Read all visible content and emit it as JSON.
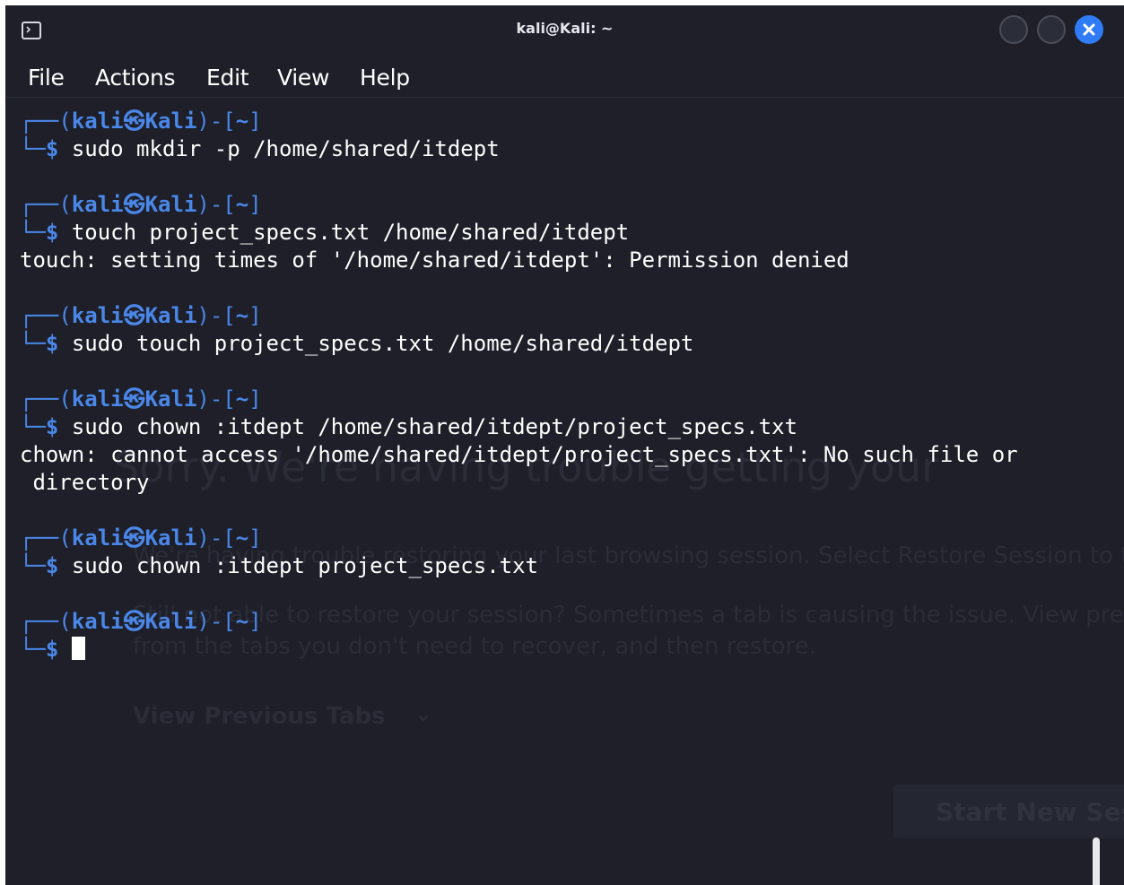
{
  "window": {
    "title": "kali@Kali: ~",
    "icons": {
      "app": "terminal-icon",
      "minimize": "minimize-icon",
      "maximize": "maximize-icon",
      "close": "close-icon"
    },
    "colors": {
      "background": "#1e1f29",
      "prompt": "#4a87e8",
      "close_button": "#2f7cf6",
      "text": "#ffffff"
    }
  },
  "menu": [
    "File",
    "Actions",
    "Edit",
    "View",
    "Help"
  ],
  "prompt": {
    "open": "┌──(",
    "user": "kali㉿Kali",
    "close": ")-[",
    "dir": "~",
    "end": "]",
    "corner": "└─",
    "symbol": "$"
  },
  "session": [
    {
      "command": "sudo mkdir -p /home/shared/itdept",
      "output": []
    },
    {
      "command": "touch project_specs.txt /home/shared/itdept",
      "output": [
        "touch: setting times of '/home/shared/itdept': Permission denied"
      ]
    },
    {
      "command": "sudo touch project_specs.txt /home/shared/itdept",
      "output": []
    },
    {
      "command": "sudo chown :itdept /home/shared/itdept/project_specs.txt",
      "output": [
        "chown: cannot access '/home/shared/itdept/project_specs.txt': No such file or",
        " directory"
      ]
    },
    {
      "command": "sudo chown :itdept project_specs.txt",
      "output": []
    },
    {
      "command": "",
      "output": []
    }
  ],
  "ghost_background": {
    "heading": "Sorry. We're having trouble getting your",
    "line1": "We're having trouble restoring your last browsing session. Select Restore Session to t",
    "line2": "Still not able to restore your session? Sometimes a tab is causing the issue. View previo",
    "line3": "from the tabs you don't need to recover, and then restore.",
    "view_tabs": "View Previous Tabs",
    "start_new": "Start New Sessi"
  }
}
